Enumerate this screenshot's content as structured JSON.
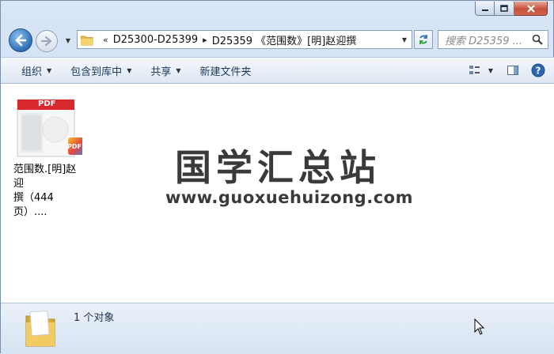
{
  "window": {
    "caption_buttons": [
      "minimize",
      "maximize",
      "close"
    ]
  },
  "address": {
    "overflow_chevron": "«",
    "crumbs": [
      "D25300-D25399",
      "D25359 《范围数》[明]赵迎撰"
    ]
  },
  "search": {
    "placeholder": "搜索 D25359 ..."
  },
  "toolbar": {
    "organize_label": "组织",
    "include_library_label": "包含到库中",
    "share_label": "共享",
    "new_folder_label": "新建文件夹"
  },
  "files": [
    {
      "name_line1": "范围数.[明]赵迎",
      "name_line2": "撰（444页）....",
      "thumb_badge": "PDF",
      "corner_badge": "PDF"
    }
  ],
  "watermark": {
    "title": "国学汇总站",
    "url": "www.guoxuehuizong.com"
  },
  "details": {
    "count_label": "1 个对象"
  },
  "colors": {
    "pdf_red": "#d9272e",
    "toolbar_text": "#1e395b",
    "back_button": "#2c6fb8"
  }
}
